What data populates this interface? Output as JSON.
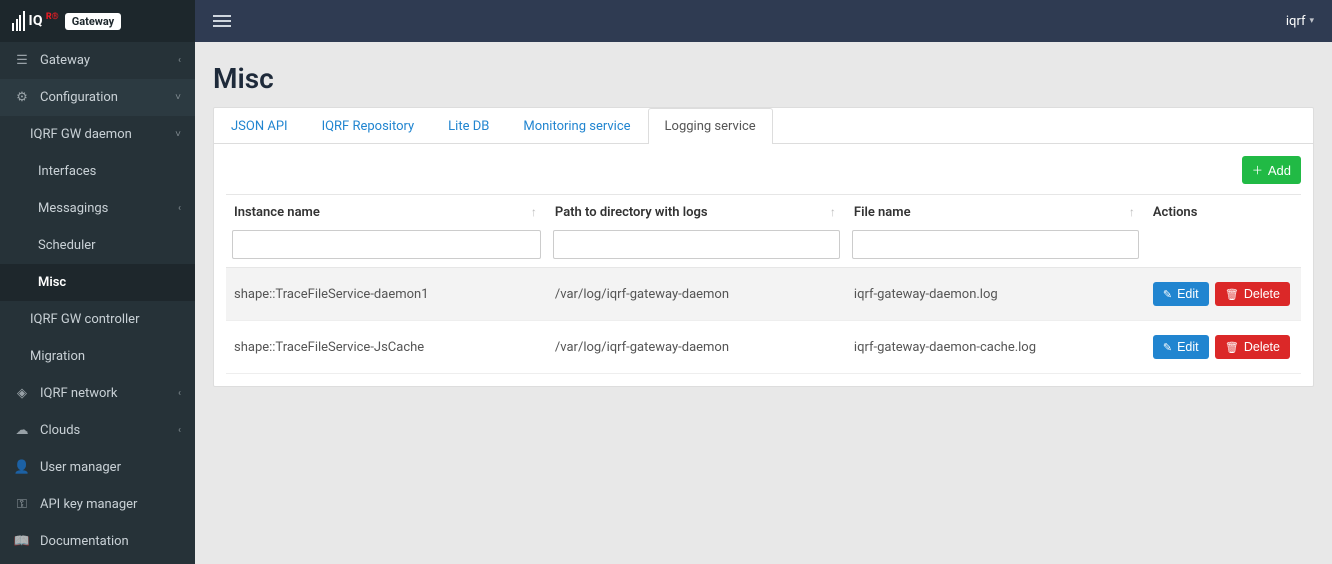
{
  "header": {
    "brand_text": "IQ",
    "brand_badge": "Gateway",
    "user": "iqrf"
  },
  "sidebar": {
    "items": [
      {
        "icon": "menu",
        "label": "Gateway",
        "chev": "‹"
      },
      {
        "icon": "gear",
        "label": "Configuration",
        "chev": "˅",
        "expanded": true
      },
      {
        "label": "IQRF GW daemon",
        "chev": "˅",
        "sub": true
      },
      {
        "label": "Interfaces",
        "sub2": true
      },
      {
        "label": "Messagings",
        "chev": "‹",
        "sub2": true
      },
      {
        "label": "Scheduler",
        "sub2": true
      },
      {
        "label": "Misc",
        "sub2": true,
        "active": true
      },
      {
        "label": "IQRF GW controller",
        "sub": true
      },
      {
        "label": "Migration",
        "sub": true
      },
      {
        "icon": "wifi",
        "label": "IQRF network",
        "chev": "‹"
      },
      {
        "icon": "cloud",
        "label": "Clouds",
        "chev": "‹"
      },
      {
        "icon": "user",
        "label": "User manager"
      },
      {
        "icon": "key",
        "label": "API key manager"
      },
      {
        "icon": "book",
        "label": "Documentation"
      }
    ]
  },
  "page": {
    "title": "Misc"
  },
  "tabs": [
    {
      "label": "JSON API"
    },
    {
      "label": "IQRF Repository"
    },
    {
      "label": "Lite DB"
    },
    {
      "label": "Monitoring service"
    },
    {
      "label": "Logging service",
      "active": true
    }
  ],
  "toolbar": {
    "add_label": "Add"
  },
  "table": {
    "columns": {
      "instance": "Instance name",
      "path": "Path to directory with logs",
      "file": "File name",
      "actions": "Actions"
    },
    "edit_label": "Edit",
    "delete_label": "Delete",
    "rows": [
      {
        "instance": "shape::TraceFileService-daemon1",
        "path": "/var/log/iqrf-gateway-daemon",
        "file": "iqrf-gateway-daemon.log"
      },
      {
        "instance": "shape::TraceFileService-JsCache",
        "path": "/var/log/iqrf-gateway-daemon",
        "file": "iqrf-gateway-daemon-cache.log"
      }
    ]
  }
}
